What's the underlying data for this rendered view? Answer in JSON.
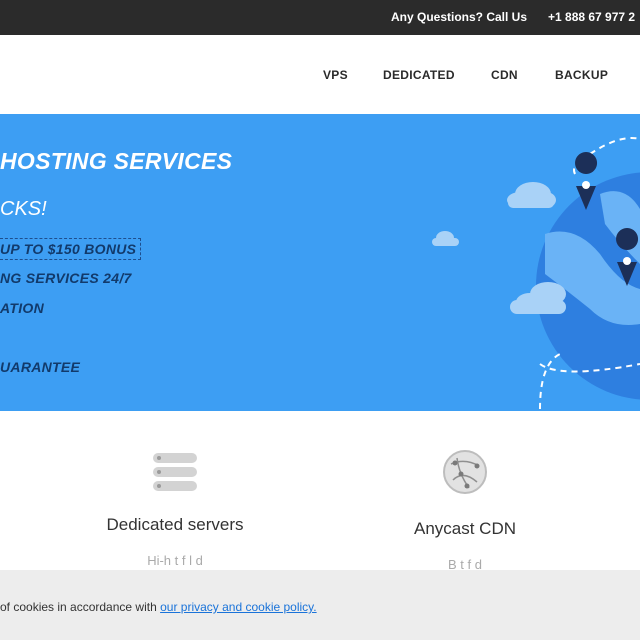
{
  "topbar": {
    "questions": "Any Questions? Call Us",
    "phone": "+1 888 67 977 2"
  },
  "nav": {
    "items": [
      "VPS",
      "DEDICATED",
      "CDN",
      "BACKUP"
    ]
  },
  "hero": {
    "title": "HOSTING SERVICES",
    "subtitle": "CKS!",
    "bonus": "UP TO $150 BONUS",
    "line2": "NG SERVICES 24/7",
    "line3": "ATION",
    "line4": "UARANTEE"
  },
  "features": [
    {
      "title": "Dedicated servers",
      "desc": "Hi-h t f l d",
      "icon": "server-stack-icon"
    },
    {
      "title": "Anycast CDN",
      "desc": "B t f d",
      "icon": "globe-network-icon"
    }
  ],
  "cookie": {
    "text": " of cookies in accordance with ",
    "link": "our privacy and cookie policy."
  },
  "colors": {
    "topbar": "#2b2b2b",
    "hero": "#3d9ef3",
    "globe": "#2e7fe0",
    "link": "#1a73d9"
  }
}
